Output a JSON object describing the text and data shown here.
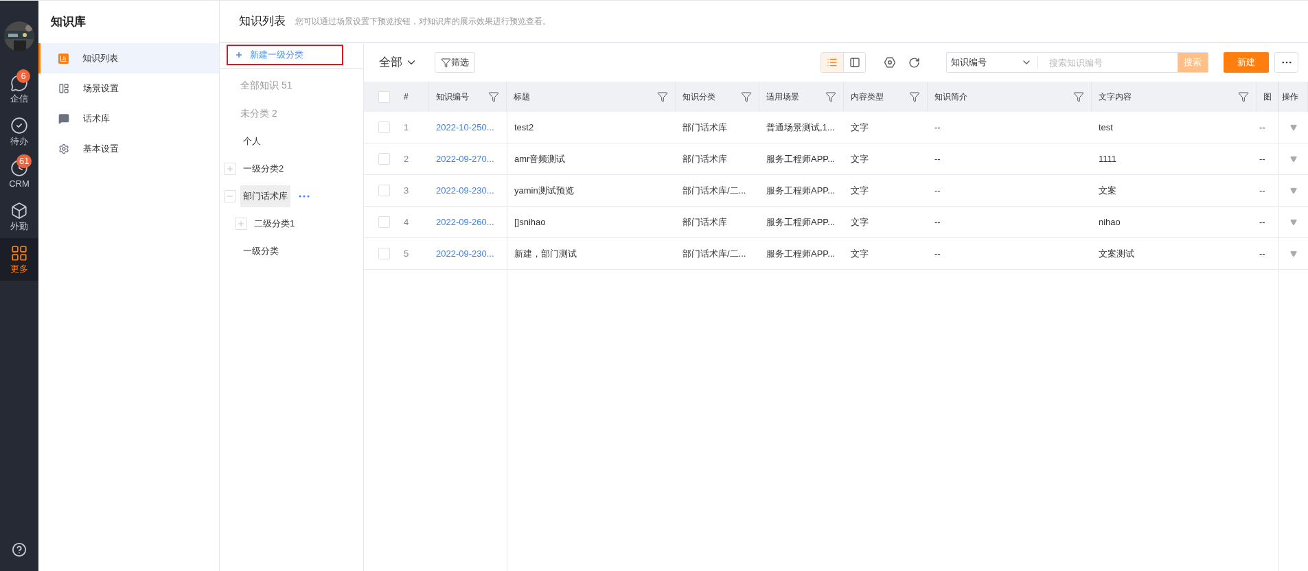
{
  "nav": {
    "items": [
      {
        "label": "企信",
        "kind": "chat",
        "badge": "6",
        "selected": false
      },
      {
        "label": "待办",
        "kind": "todo",
        "selected": false
      },
      {
        "label": "CRM",
        "kind": "clock",
        "badge": "61",
        "selected": false
      },
      {
        "label": "外勤",
        "kind": "box",
        "selected": false
      },
      {
        "label": "更多",
        "kind": "grid",
        "selected": true
      }
    ]
  },
  "sidebar": {
    "title": "知识库",
    "items": [
      {
        "label": "知识列表",
        "kind": "chart",
        "selected": true
      },
      {
        "label": "场景设置",
        "kind": "layout",
        "selected": false
      },
      {
        "label": "话术库",
        "kind": "chat",
        "selected": false
      },
      {
        "label": "基本设置",
        "kind": "gear",
        "selected": false
      }
    ]
  },
  "header": {
    "title": "知识列表",
    "hint": "您可以通过场景设置下预览按钮，对知识库的展示效果进行预览查看。"
  },
  "categories": {
    "new_button": "新建一级分类",
    "summary": [
      "全部知识 51",
      "未分类 2"
    ],
    "tree": [
      {
        "label": "个人",
        "selected": false
      },
      {
        "label": "一级分类2",
        "selected": false,
        "expanded": false
      },
      {
        "label": "部门话术库",
        "selected": true,
        "expanded": true,
        "children": [
          {
            "label": "二级分类1",
            "selected": false,
            "expanded": false
          }
        ]
      },
      {
        "label": "一级分类",
        "selected": false
      }
    ]
  },
  "toolbar": {
    "scope": "全部",
    "filter_button": "筛选",
    "view_modes": [
      {
        "kind": "list",
        "selected": true
      },
      {
        "kind": "panel",
        "selected": false
      }
    ],
    "search_field": "知识编号",
    "search_placeholder": "搜索知识编号",
    "search_button": "搜索",
    "search_disabled": true,
    "new_button": "新建"
  },
  "table": {
    "select_all_checked": false,
    "columns": [
      {
        "label": "#",
        "filter": false
      },
      {
        "label": "知识编号",
        "filter": true
      },
      {
        "label": "标题",
        "filter": true
      },
      {
        "label": "知识分类",
        "filter": true
      },
      {
        "label": "适用场景",
        "filter": true
      },
      {
        "label": "内容类型",
        "filter": true
      },
      {
        "label": "知识简介",
        "filter": true
      },
      {
        "label": "文字内容",
        "filter": true
      },
      {
        "label": "图"
      },
      {
        "label": "操作",
        "filter": false
      }
    ],
    "rows": [
      {
        "checked": false,
        "cells": [
          "1",
          "2022-10-250...",
          "test2",
          "部门话术库",
          "普通场景测试,1...",
          "文字",
          "--",
          "test",
          "--"
        ]
      },
      {
        "checked": false,
        "cells": [
          "2",
          "2022-09-270...",
          "amr音频测试",
          "部门话术库",
          "服务工程师APP...",
          "文字",
          "--",
          "1111",
          "--"
        ]
      },
      {
        "checked": false,
        "cells": [
          "3",
          "2022-09-230...",
          "yamin测试预览",
          "部门话术库/二...",
          "服务工程师APP...",
          "文字",
          "--",
          "文案",
          "--"
        ]
      },
      {
        "checked": false,
        "cells": [
          "4",
          "2022-09-260...",
          "[]snihao",
          "部门话术库",
          "服务工程师APP...",
          "文字",
          "--",
          "nihao",
          "--"
        ]
      },
      {
        "checked": false,
        "cells": [
          "5",
          "2022-09-230...",
          "新建，部门测试",
          "部门话术库/二...",
          "服务工程师APP...",
          "文字",
          "--",
          "文案测试",
          "--"
        ]
      }
    ]
  }
}
